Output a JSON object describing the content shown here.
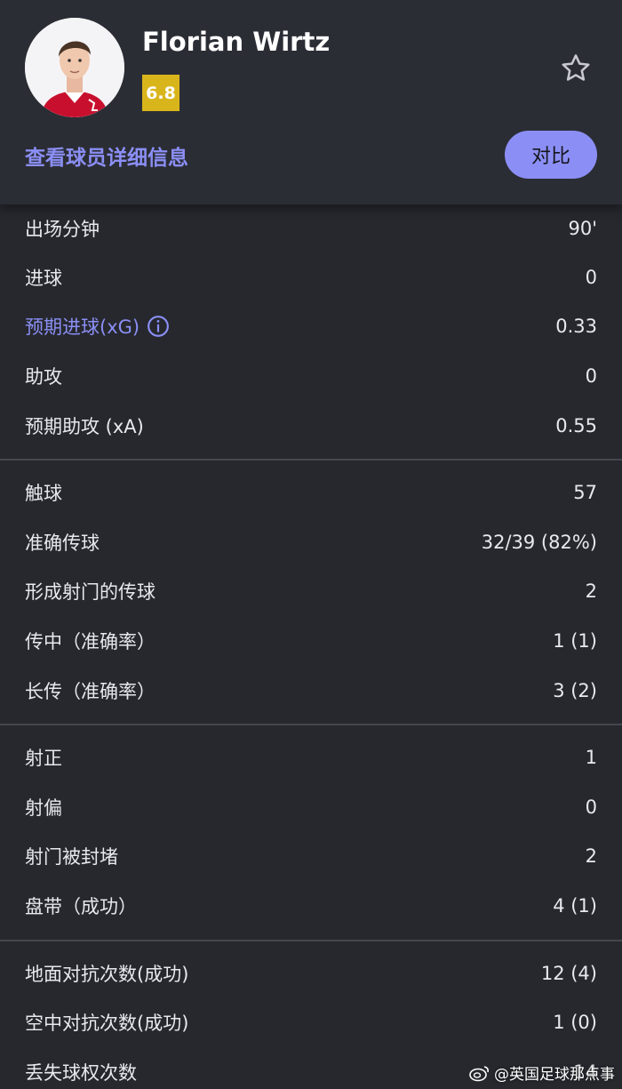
{
  "header": {
    "player_name": "Florian Wirtz",
    "rating": "6.8",
    "details_link": "查看球员详细信息",
    "compare_button": "对比",
    "avatar_icon": "player-avatar",
    "favorite_icon": "star-outline-icon",
    "accent_color": "#8b8ff5",
    "rating_color": "#d9b51c"
  },
  "sections": [
    {
      "rows": [
        {
          "label": "出场分钟",
          "value": "90'"
        },
        {
          "label": "进球",
          "value": "0"
        },
        {
          "label": "预期进球(xG)",
          "value": "0.33"
        },
        {
          "label": "助攻",
          "value": "0"
        },
        {
          "label": "预期助攻 (xA)",
          "value": "0.55"
        }
      ]
    },
    {
      "rows": [
        {
          "label": "触球",
          "value": "57"
        },
        {
          "label": "准确传球",
          "value": "32/39 (82%)"
        },
        {
          "label": "形成射门的传球",
          "value": "2"
        },
        {
          "label": "传中（准确率）",
          "value": "1 (1)"
        },
        {
          "label": "长传（准确率）",
          "value": "3 (2)"
        }
      ]
    },
    {
      "rows": [
        {
          "label": "射正",
          "value": "1"
        },
        {
          "label": "射偏",
          "value": "0"
        },
        {
          "label": "射门被封堵",
          "value": "2"
        },
        {
          "label": "盘带（成功）",
          "value": "4 (1)"
        }
      ]
    },
    {
      "rows": [
        {
          "label": "地面对抗次数(成功)",
          "value": "12 (4)"
        },
        {
          "label": "空中对抗次数(成功)",
          "value": "1 (0)"
        },
        {
          "label": "丢失球权次数",
          "value": "14"
        }
      ]
    }
  ],
  "watermark": "@英国足球那点事"
}
